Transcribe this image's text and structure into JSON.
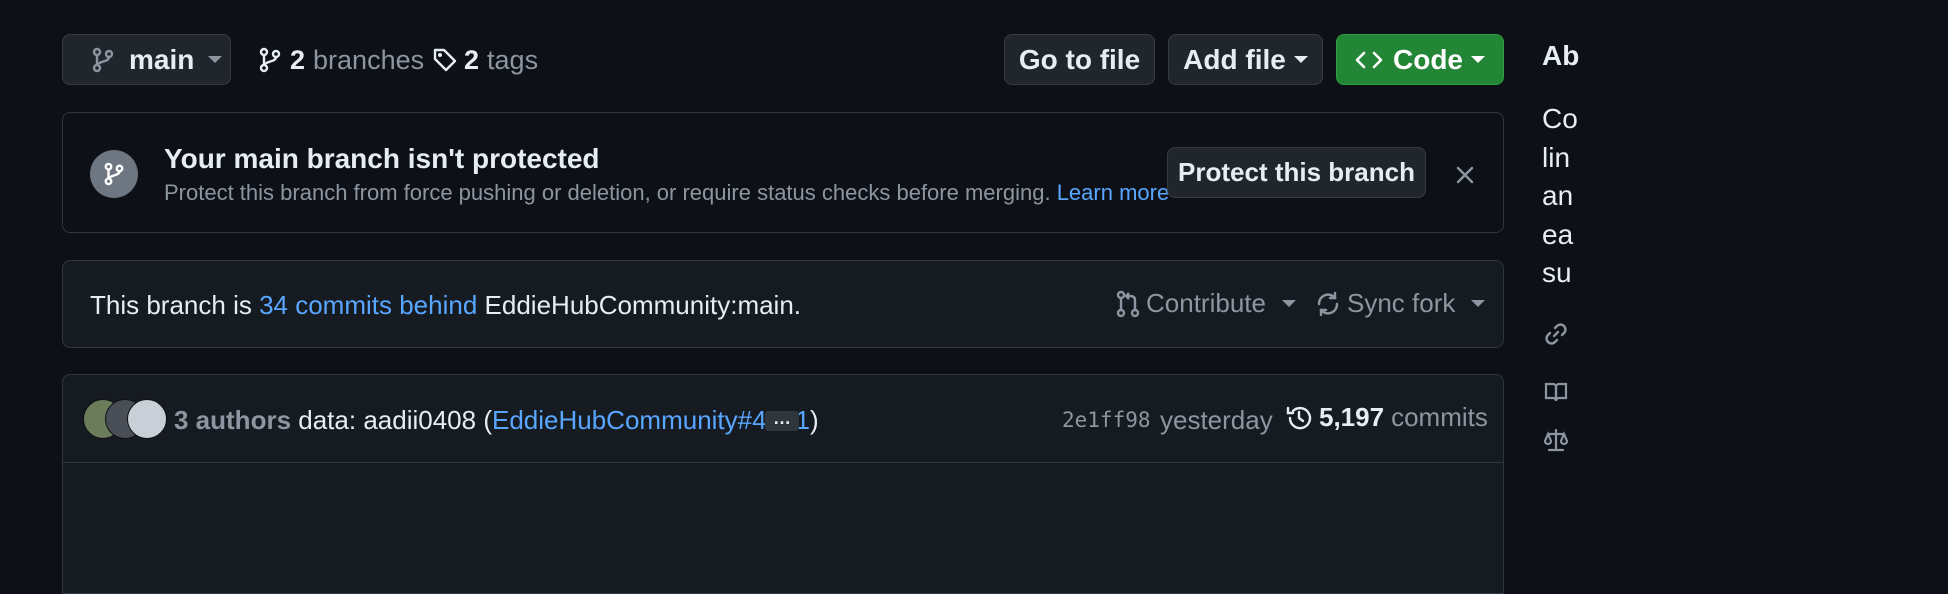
{
  "toolbar": {
    "branch_name": "main",
    "branches_count": "2",
    "branches_label": "branches",
    "tags_count": "2",
    "tags_label": "tags",
    "go_to_file": "Go to file",
    "add_file": "Add file",
    "code": "Code"
  },
  "protect_banner": {
    "title": "Your main branch isn't protected",
    "description": "Protect this branch from force pushing or deletion, or require status checks before merging.",
    "learn_more": "Learn more",
    "protect_button": "Protect this branch"
  },
  "fork_status": {
    "prefix": "This branch is",
    "behind_link": "34 commits behind",
    "upstream": "EddieHubCommunity:main.",
    "contribute": "Contribute",
    "sync_fork": "Sync fork"
  },
  "latest_commit": {
    "authors": "3 authors",
    "message_prefix": "data: aadii0408 (",
    "pr_link": "EddieHubCommunity#4741",
    "message_suffix": ")",
    "ellipsis": "…",
    "sha": "2e1ff98",
    "time": "yesterday",
    "commits_count": "5,197",
    "commits_label": "commits"
  },
  "sidebar": {
    "heading_fragment": "Ab",
    "about_lines": [
      "Co",
      "lin",
      "an",
      "ea",
      "su"
    ]
  },
  "colors": {
    "background": "#0d1117",
    "code_button": "#238636",
    "link": "#58a6ff"
  }
}
